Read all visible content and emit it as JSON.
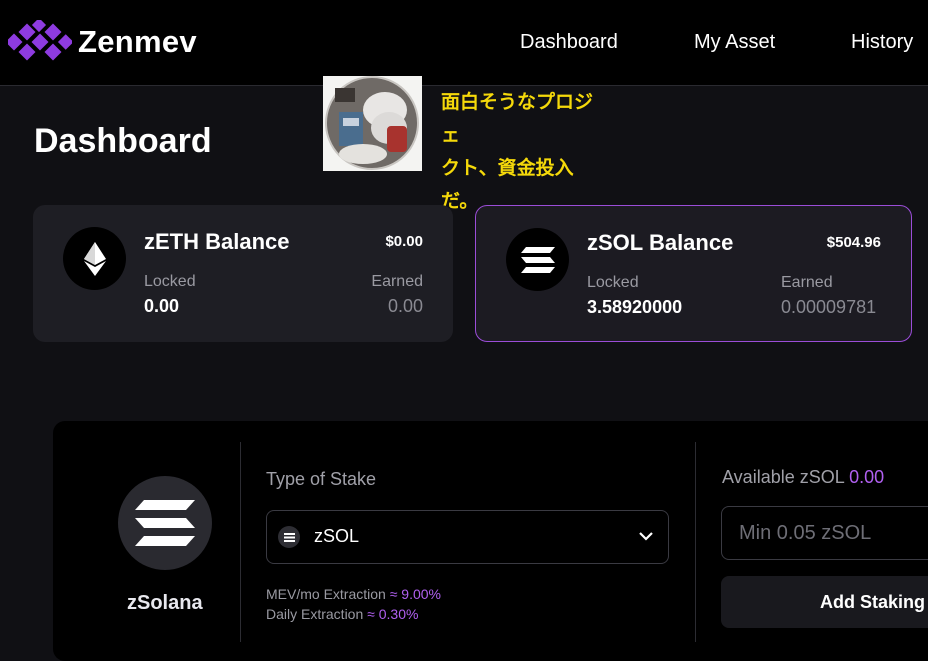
{
  "header": {
    "brand": "Zenmev",
    "nav": [
      "Dashboard",
      "My Asset",
      "History"
    ]
  },
  "page": {
    "title": "Dashboard"
  },
  "overlay": {
    "caption_line1": "面白そうなプロジェ",
    "caption_line2": "クト、資金投入だ。"
  },
  "balances": [
    {
      "title": "zETH Balance",
      "usd": "$0.00",
      "locked_label": "Locked",
      "locked": "0.00",
      "earned_label": "Earned",
      "earned": "0.00",
      "icon": "ethereum-icon"
    },
    {
      "title": "zSOL Balance",
      "usd": "$504.96",
      "locked_label": "Locked",
      "locked": "3.58920000",
      "earned_label": "Earned",
      "earned": "0.00009781",
      "icon": "solana-icon",
      "selected": true
    }
  ],
  "stake": {
    "coin_name": "zSolana",
    "type_label": "Type of Stake",
    "selected": "zSOL",
    "mev_label": "MEV/mo Extraction",
    "mev_value": "≈ 9.00%",
    "daily_label": "Daily Extraction",
    "daily_value": "≈ 0.30%",
    "available_label": "Available zSOL",
    "available_value": "0.00",
    "amount_placeholder": "Min 0.05 zSOL",
    "add_button": "Add Staking"
  },
  "colors": {
    "accent": "#9b4dd8",
    "caption": "#f5d90a",
    "background": "#101014"
  }
}
